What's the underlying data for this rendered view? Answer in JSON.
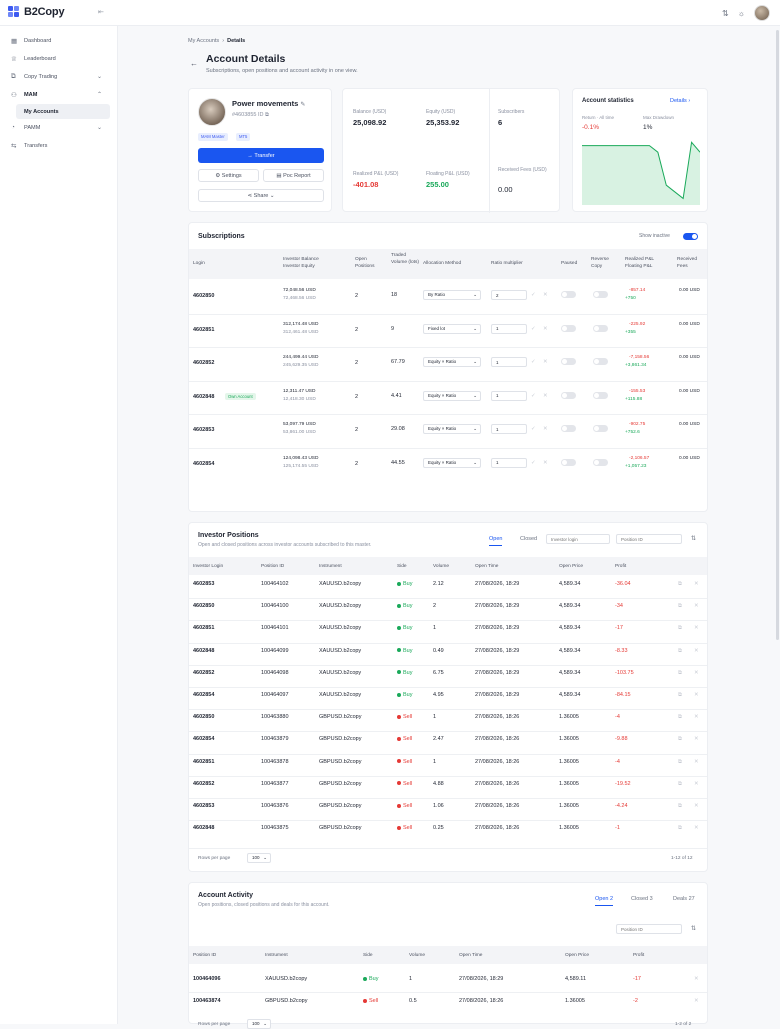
{
  "app": {
    "name": "B2Copy"
  },
  "sidebar": {
    "items": [
      {
        "label": "Dashboard",
        "icon": "dashboard-icon"
      },
      {
        "label": "Leaderboard",
        "icon": "trophy-icon"
      },
      {
        "label": "Copy Trading",
        "icon": "copy-icon"
      },
      {
        "label": "MAM",
        "icon": "users-icon"
      },
      {
        "label": "My Accounts",
        "icon": ""
      },
      {
        "label": "PAMM",
        "icon": "pie-icon"
      },
      {
        "label": "Transfers",
        "icon": "transfer-icon"
      }
    ]
  },
  "breadcrumb": {
    "parent": "My Accounts",
    "current": "Details"
  },
  "page": {
    "title": "Account Details",
    "subtitle": "Subscriptions, open positions and account activity in one view."
  },
  "profile": {
    "name": "Power movements",
    "id": "#4603855 ID",
    "badges": [
      "MAM Master",
      "MT5"
    ],
    "transfer": "→ Transfer",
    "settings": "Settings",
    "poc": "Poc Report",
    "share": "Share"
  },
  "stats": {
    "balance_label": "Balance (USD)",
    "balance": "25,098.92",
    "equity_label": "Equity (USD)",
    "equity": "25,353.92",
    "subs_label": "Subscribers",
    "subs": "6",
    "rpl_label": "Realized P&L (USD)",
    "rpl": "-401.08",
    "fpl_label": "Floating P&L (USD)",
    "fpl": "255.00",
    "fees_label": "Received Fees (USD)",
    "fees": "0.00"
  },
  "account_stats": {
    "title": "Account statistics",
    "details": "Details ›",
    "return_label": "Return · All time",
    "return": "-0.1%",
    "dd_label": "Max Drawdown",
    "dd": "1%"
  },
  "subscriptions": {
    "title": "Subscriptions",
    "show_inactive": "Show inactive",
    "headers": [
      "Login",
      "Investor Balance Investor Equity",
      "Open Positions",
      "Traded Volume (lots)",
      "Allocation Method",
      "Ratio multiplier",
      "Paused",
      "Reverse Copy",
      "Realized P&L Floating P&L",
      "Received Fees"
    ],
    "rows": [
      {
        "login": "4602850",
        "own": "",
        "balance": "72,048.56 USD",
        "equity": "72,468.56 USD",
        "open": "2",
        "volume": "18",
        "method": "By Ratio",
        "ratio": "2",
        "rpl": "-857.14",
        "fpl": "+750",
        "fees": "0.00 USD"
      },
      {
        "login": "4602851",
        "own": "",
        "balance": "312,174.48 USD",
        "equity": "312,461.48 USD",
        "open": "2",
        "volume": "9",
        "method": "Fixed lot",
        "ratio": "1",
        "rpl": "-225.92",
        "fpl": "+355",
        "fees": "0.00 USD"
      },
      {
        "login": "4602852",
        "own": "",
        "balance": "244,499.44 USD",
        "equity": "245,629.35 USD",
        "open": "2",
        "volume": "67.79",
        "method": "Equity × Ratio",
        "ratio": "1",
        "rpl": "-7,158.56",
        "fpl": "+3,861.34",
        "fees": "0.00 USD"
      },
      {
        "login": "4602848",
        "own": "Own Account",
        "balance": "12,311.47 USD",
        "equity": "12,418.30 USD",
        "open": "2",
        "volume": "4.41",
        "method": "Equity × Ratio",
        "ratio": "1",
        "rpl": "-155.53",
        "fpl": "+115.88",
        "fees": "0.00 USD"
      },
      {
        "login": "4602853",
        "own": "",
        "balance": "53,097.79 USD",
        "equity": "53,861.00 USD",
        "open": "2",
        "volume": "29.08",
        "method": "Equity × Ratio",
        "ratio": "1",
        "rpl": "-902.75",
        "fpl": "+752.6",
        "fees": "0.00 USD"
      },
      {
        "login": "4602854",
        "own": "",
        "balance": "124,098.43 USD",
        "equity": "125,174.55 USD",
        "open": "2",
        "volume": "44.55",
        "method": "Equity × Ratio",
        "ratio": "1",
        "rpl": "-2,106.57",
        "fpl": "+1,057.23",
        "fees": "0.00 USD"
      }
    ]
  },
  "positions": {
    "title": "Investor Positions",
    "subtitle": "Open and closed positions across investor accounts subscribed to this master.",
    "tab_open": "Open",
    "tab_closed": "Closed",
    "login_placeholder": "Investor login",
    "pos_placeholder": "Position ID",
    "headers": [
      "Investor Login",
      "Position ID",
      "Instrument",
      "Side",
      "Volume",
      "Open Time",
      "Open Price",
      "Profit"
    ],
    "rows": [
      {
        "login": "4602853",
        "pid": "100464102",
        "inst": "XAUUSD.b2copy",
        "side": "Buy",
        "vol": "2.12",
        "time": "27/08/2026, 18:29",
        "price": "4,589.34",
        "profit": "-36.04"
      },
      {
        "login": "4602850",
        "pid": "100464100",
        "inst": "XAUUSD.b2copy",
        "side": "Buy",
        "vol": "2",
        "time": "27/08/2026, 18:29",
        "price": "4,589.34",
        "profit": "-34"
      },
      {
        "login": "4602851",
        "pid": "100464101",
        "inst": "XAUUSD.b2copy",
        "side": "Buy",
        "vol": "1",
        "time": "27/08/2026, 18:29",
        "price": "4,589.34",
        "profit": "-17"
      },
      {
        "login": "4602848",
        "pid": "100464099",
        "inst": "XAUUSD.b2copy",
        "side": "Buy",
        "vol": "0.49",
        "time": "27/08/2026, 18:29",
        "price": "4,589.34",
        "profit": "-8.33"
      },
      {
        "login": "4602852",
        "pid": "100464098",
        "inst": "XAUUSD.b2copy",
        "side": "Buy",
        "vol": "6.75",
        "time": "27/08/2026, 18:29",
        "price": "4,589.34",
        "profit": "-103.75"
      },
      {
        "login": "4602854",
        "pid": "100464097",
        "inst": "XAUUSD.b2copy",
        "side": "Buy",
        "vol": "4.95",
        "time": "27/08/2026, 18:29",
        "price": "4,589.34",
        "profit": "-84.15"
      },
      {
        "login": "4602850",
        "pid": "100463880",
        "inst": "GBPUSD.b2copy",
        "side": "Sell",
        "vol": "1",
        "time": "27/08/2026, 18:26",
        "price": "1.36005",
        "profit": "-4"
      },
      {
        "login": "4602854",
        "pid": "100463879",
        "inst": "GBPUSD.b2copy",
        "side": "Sell",
        "vol": "2.47",
        "time": "27/08/2026, 18:26",
        "price": "1.36005",
        "profit": "-9.88"
      },
      {
        "login": "4602851",
        "pid": "100463878",
        "inst": "GBPUSD.b2copy",
        "side": "Sell",
        "vol": "1",
        "time": "27/08/2026, 18:26",
        "price": "1.36005",
        "profit": "-4"
      },
      {
        "login": "4602852",
        "pid": "100463877",
        "inst": "GBPUSD.b2copy",
        "side": "Sell",
        "vol": "4.88",
        "time": "27/08/2026, 18:26",
        "price": "1.36005",
        "profit": "-19.52"
      },
      {
        "login": "4602853",
        "pid": "100463876",
        "inst": "GBPUSD.b2copy",
        "side": "Sell",
        "vol": "1.06",
        "time": "27/08/2026, 18:26",
        "price": "1.36005",
        "profit": "-4.24"
      },
      {
        "login": "4602848",
        "pid": "100463875",
        "inst": "GBPUSD.b2copy",
        "side": "Sell",
        "vol": "0.25",
        "time": "27/08/2026, 18:26",
        "price": "1.36005",
        "profit": "-1"
      }
    ],
    "rows_per_page": "Rows per page",
    "page_size": "100",
    "range": "1-12 of 12"
  },
  "activity": {
    "title": "Account Activity",
    "subtitle": "Open positions, closed positions and deals for this account.",
    "tab_open": "Open 2",
    "tab_closed": "Closed 3",
    "tab_deals": "Deals 27",
    "pos_placeholder": "Position ID",
    "headers": [
      "Position ID",
      "Instrument",
      "Side",
      "Volume",
      "Open Time",
      "Open Price",
      "Profit"
    ],
    "rows": [
      {
        "pid": "100464096",
        "inst": "XAUUSD.b2copy",
        "side": "Buy",
        "vol": "1",
        "time": "27/08/2026, 18:29",
        "price": "4,589.11",
        "profit": "-17"
      },
      {
        "pid": "100463874",
        "inst": "GBPUSD.b2copy",
        "side": "Sell",
        "vol": "0.5",
        "time": "27/08/2026, 18:26",
        "price": "1.36005",
        "profit": "-2"
      }
    ],
    "rows_per_page": "Rows per page",
    "page_size": "100",
    "range": "1-2 of 2"
  },
  "chart_data": {
    "type": "area",
    "series": [
      {
        "values": [
          0,
          0,
          0,
          0,
          0,
          0,
          0,
          0,
          0,
          -0.1,
          -0.6,
          -0.7,
          -0.8,
          0.05,
          -0.1
        ]
      }
    ]
  },
  "colors": {
    "accent": "#1a56f0",
    "negative": "#e53935",
    "positive": "#1aa95a"
  }
}
